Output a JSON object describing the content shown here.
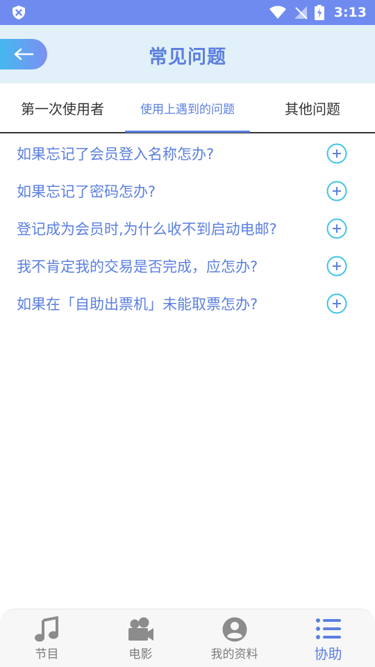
{
  "status_bar": {
    "time": "3:13"
  },
  "header": {
    "title": "常见问题"
  },
  "tabs": [
    {
      "label": "第一次使用者",
      "active": false
    },
    {
      "label": "使用上遇到的问题",
      "active": true
    },
    {
      "label": "其他问题",
      "active": false
    }
  ],
  "faq": [
    {
      "question": "如果忘记了会员登入名称怎办?"
    },
    {
      "question": "如果忘记了密码怎办?"
    },
    {
      "question": "登记成为会员时,为什么收不到启动电邮?"
    },
    {
      "question": "我不肯定我的交易是否完成，应怎办?"
    },
    {
      "question": "如果在「自助出票机」未能取票怎办?"
    }
  ],
  "bottom_nav": [
    {
      "label": "节目",
      "icon": "music-note-icon",
      "active": false
    },
    {
      "label": "电影",
      "icon": "movie-camera-icon",
      "active": false
    },
    {
      "label": "我的资料",
      "icon": "user-icon",
      "active": false
    },
    {
      "label": "协助",
      "icon": "list-icon",
      "active": true
    }
  ],
  "colors": {
    "accent": "#5b7fe0",
    "status_bar": "#6f8bf0",
    "header_bg": "#e2f0f9",
    "plus_icon": "#3ec3e8",
    "inactive_nav": "#7a7a7a"
  }
}
